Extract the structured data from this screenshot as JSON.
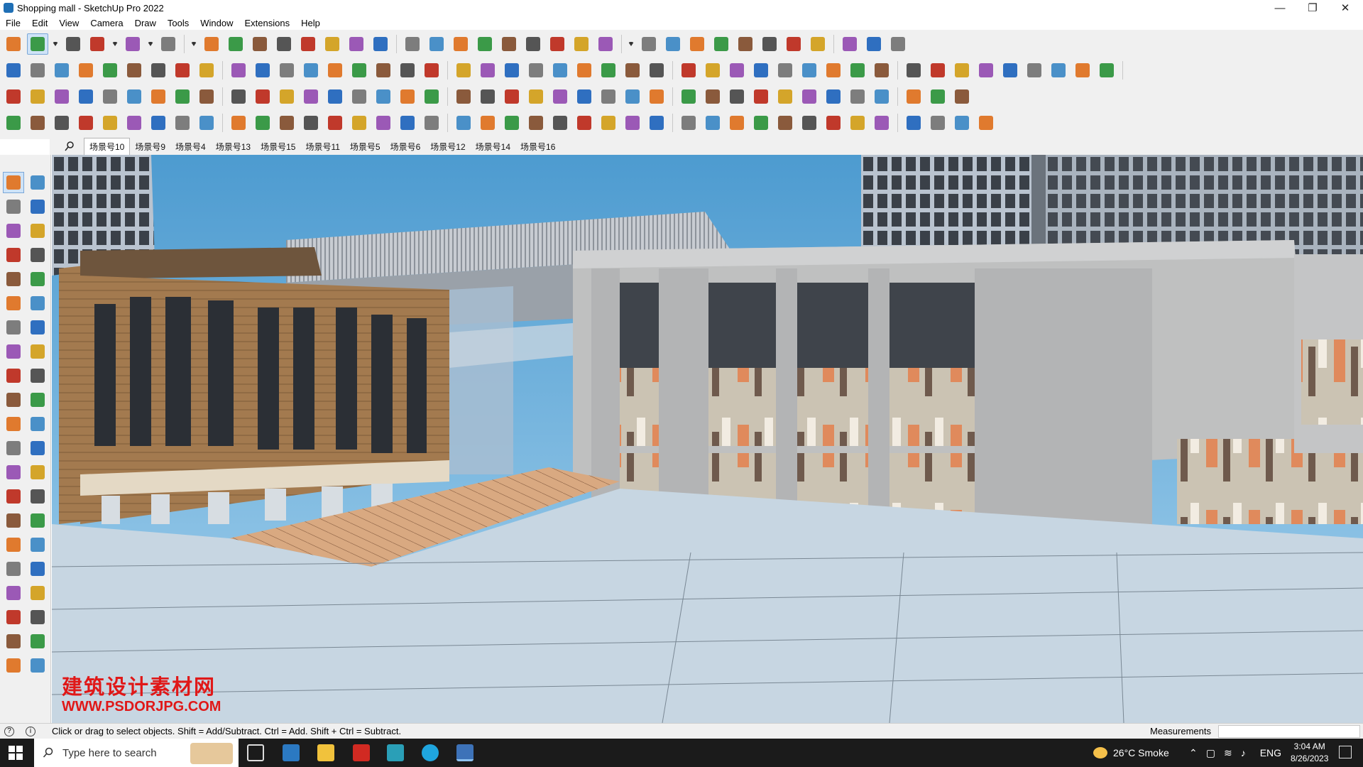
{
  "window": {
    "title": "Shopping mall - SketchUp Pro 2022",
    "minimize": "—",
    "maximize": "❐",
    "close": "✕"
  },
  "menu": [
    "File",
    "Edit",
    "View",
    "Camera",
    "Draw",
    "Tools",
    "Window",
    "Extensions",
    "Help"
  ],
  "scenes": {
    "tabs": [
      "场景号10",
      "场景号9",
      "场景号4",
      "场景号13",
      "场景号15",
      "场景号11",
      "场景号5",
      "场景号6",
      "场景号12",
      "场景号14",
      "场景号16"
    ],
    "selected": "场景号10"
  },
  "toolbar_icons": {
    "row1": [
      "zoom-icon",
      "select-icon",
      "dropdown-icon",
      "eraser-icon",
      "pencil-icon",
      "dropdown-icon",
      "lasso-icon",
      "dropdown-icon",
      "rectangle-icon",
      "dropdown-icon",
      "pushpull-icon",
      "followme-icon",
      "move-icon",
      "rotate-icon",
      "scale-icon",
      "tape-icon",
      "text-icon",
      "paint-icon",
      "orbit-icon",
      "pan-icon",
      "zoom-window-icon",
      "zoom-extents-icon",
      "component-icon",
      "style-icon",
      "layer-icon",
      "scene-icon",
      "user-icon",
      "dropdown-icon",
      "warehouse-icon",
      "extension-warehouse-icon",
      "send-layout-icon",
      "sandbox-icon",
      "intersect-icon",
      "sort-icon",
      "line-icon",
      "mirror-icon",
      "undo-icon",
      "redo-icon",
      "tag-icon"
    ],
    "row2": [
      "box-icon",
      "solid-icon",
      "solid-icon",
      "push-icon",
      "push-icon",
      "push-icon",
      "push-icon",
      "push-icon",
      "push-icon",
      "push-icon",
      "push-icon",
      "curve-icon",
      "section-icon",
      "section-icon",
      "section-icon",
      "terrain-icon",
      "terrain-icon",
      "house-icon",
      "house-icon",
      "house-icon",
      "house-icon",
      "house-icon",
      "house-icon",
      "fx-icon",
      "leaf-icon",
      "ruler-icon",
      "shape-icon",
      "shape-icon",
      "shape-icon",
      "shape-icon",
      "shape-icon",
      "shape-icon",
      "shape-icon",
      "shape-icon",
      "shape-icon",
      "shape-icon",
      "measure-icon",
      "eraser-icon",
      "roof-icon",
      "grid-icon",
      "roof-icon",
      "roof-icon",
      "roof-icon",
      "roof-icon",
      "roof-icon"
    ],
    "row3": [
      "plane-icon",
      "plane-icon",
      "plane-icon",
      "text-icon",
      "component-icon",
      "plane-icon",
      "arc-icon",
      "box-icon",
      "box-icon",
      "box-icon",
      "box-icon",
      "curve-icon",
      "curve-icon",
      "arc-icon",
      "move-icon",
      "move-icon",
      "cross-icon",
      "cone-icon",
      "cone-icon",
      "triangle-icon",
      "rope-icon",
      "rope-icon",
      "rope-icon",
      "move-icon",
      "box-icon",
      "rope-icon",
      "box-icon",
      "box-icon",
      "box-icon",
      "box-icon",
      "box-icon",
      "box-icon",
      "box-icon",
      "grid-icon",
      "grid-icon",
      "grid-icon",
      "cross-icon",
      "arc-icon",
      "grid-icon"
    ],
    "row4": [
      "edge-icon",
      "path-icon",
      "car-icon",
      "box-icon",
      "box-icon",
      "box-icon",
      "box-icon",
      "box-icon",
      "box-icon",
      "path-icon",
      "path-icon",
      "path-icon",
      "path-icon",
      "box-icon",
      "box-icon",
      "box-icon",
      "box-icon",
      "box-icon",
      "box-icon",
      "box-icon",
      "box-icon",
      "box-icon",
      "box-icon",
      "box-icon",
      "box-icon",
      "box-icon",
      "box-icon",
      "box-icon",
      "box-icon",
      "box-icon",
      "box-icon",
      "box-icon",
      "box-icon",
      "box-icon",
      "box-icon",
      "box-icon",
      "box-icon",
      "box-icon",
      "box-icon",
      "box-icon"
    ]
  },
  "viewport": {
    "watermark_cn": "建筑设计素材网",
    "watermark_url": "WWW.PSDORJPG.COM"
  },
  "status": {
    "hint": "Click or drag to select objects. Shift = Add/Subtract. Ctrl = Add. Shift + Ctrl = Subtract.",
    "measurements_label": "Measurements",
    "info_icon": "i",
    "geo_icon": "?"
  },
  "taskbar": {
    "search_placeholder": "Type here to search",
    "weather": "26°C  Smoke",
    "lang": "ENG",
    "time": "3:04 AM",
    "date": "8/26/2023"
  }
}
